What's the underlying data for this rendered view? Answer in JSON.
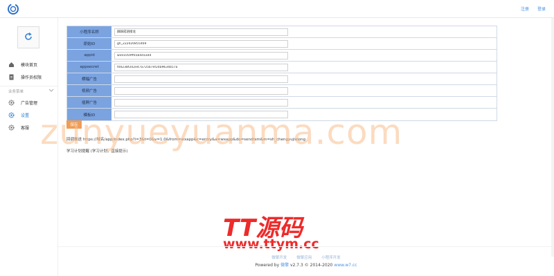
{
  "header": {
    "register": "注册",
    "login": "登录"
  },
  "sidebar": {
    "items": [
      {
        "label": "模块首页"
      },
      {
        "label": "操作员权限"
      }
    ],
    "group_label": "业务菜单",
    "group_items": [
      {
        "label": "广告管理"
      },
      {
        "label": "设置"
      },
      {
        "label": "客服"
      }
    ]
  },
  "form": {
    "rows": [
      {
        "label": "小程序名称",
        "value": "踩踩成语接龙"
      },
      {
        "label": "原始ID",
        "value": "gh_222d20855469"
      },
      {
        "label": "appid",
        "value": "wx01059ff65b4d1a4d"
      },
      {
        "label": "appsecret",
        "value": "f00238f202e47a725b7ef24b9634b57a"
      },
      {
        "label": "横幅广告",
        "value": ""
      },
      {
        "label": "视频广告",
        "value": ""
      },
      {
        "label": "插屏广告",
        "value": ""
      },
      {
        "label": "模板ID",
        "value": ""
      }
    ],
    "save_label": "保存"
  },
  "info": {
    "line1": "回调推送 https://域名/app/index.php?i=3&t=0&v=1.0&from=wxapp&c=entry&a=wxapp&do=sendtsm&m=sh_chengyujielong",
    "line2": "学习计划提醒 (学习计划，直接提示)"
  },
  "watermark": {
    "main": "zunyueyuanma.com",
    "cn": "TT源码",
    "url": "www.ttym.cc"
  },
  "footer": {
    "links": [
      "微擎开发",
      "微擎应用",
      "小程序开发"
    ],
    "powered_prefix": "Powered by",
    "powered_brand": "微擎",
    "powered_suffix": "v2.7.3 © 2014-2020",
    "powered_site": "www.w7.cc"
  },
  "colors": {
    "label_bg": "#7ba3e0",
    "save_btn": "#f09d55",
    "link": "#4a90e2",
    "active_nav": "#2a7fd4",
    "watermark_red": "#ee2a2a"
  }
}
